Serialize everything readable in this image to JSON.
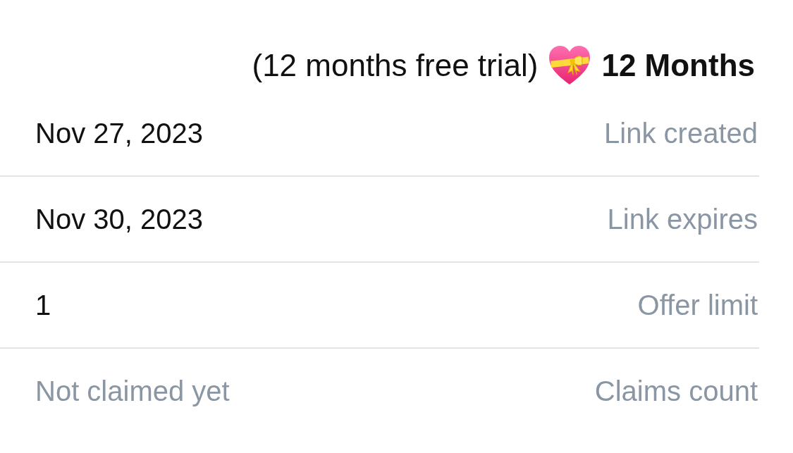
{
  "title": {
    "name": "12 Months",
    "subtitle": "(12 months free trial)"
  },
  "rows": [
    {
      "label": "Link created",
      "value": "Nov 27, 2023",
      "muted": false
    },
    {
      "label": "Link expires",
      "value": "Nov 30, 2023",
      "muted": false
    },
    {
      "label": "Offer limit",
      "value": "1",
      "muted": false
    },
    {
      "label": "Claims count",
      "value": "Not claimed yet",
      "muted": true
    }
  ]
}
